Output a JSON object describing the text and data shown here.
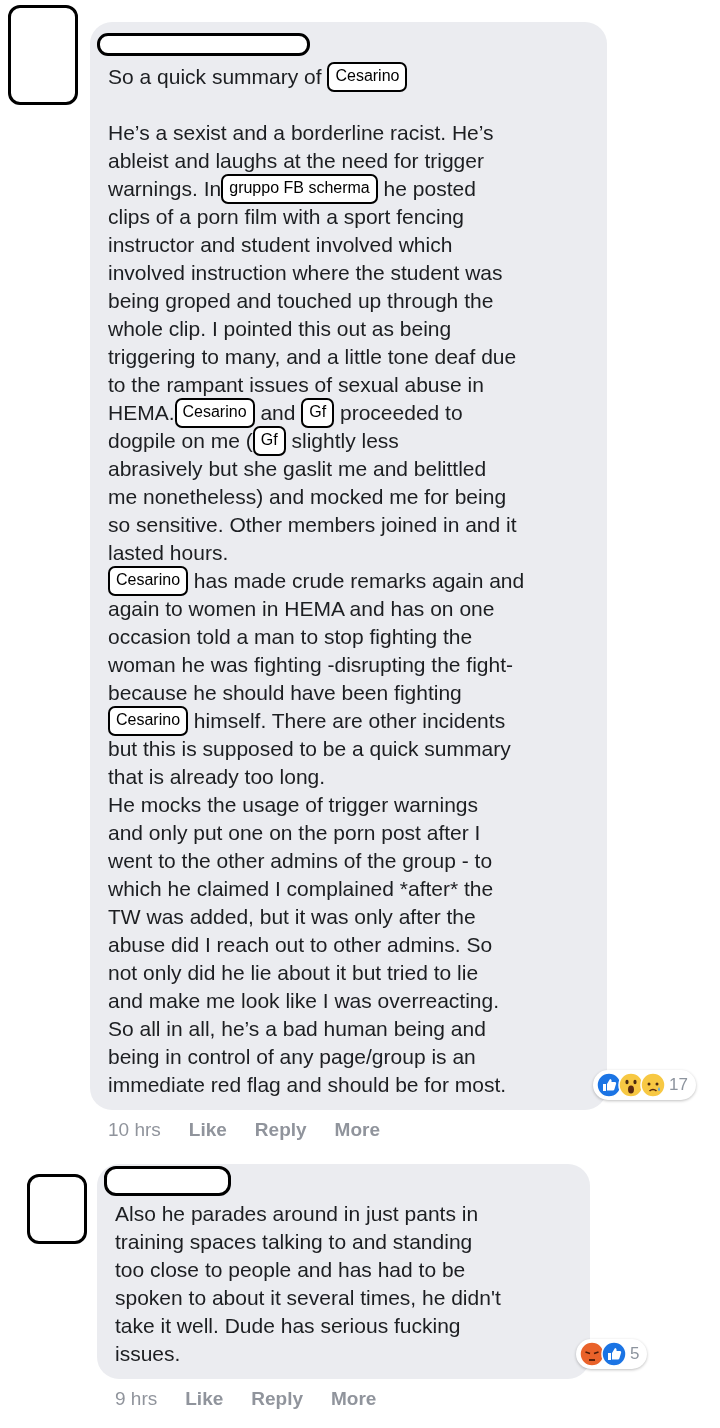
{
  "comments": [
    {
      "paragraphs": [
        [
          [
            {
              "kind": "text",
              "text": "So a quick summary of "
            },
            {
              "kind": "tag",
              "text": "Cesarino"
            }
          ]
        ],
        [
          [
            {
              "kind": "text",
              "text": "He’s a sexist and a borderline racist. He’s"
            }
          ],
          [
            {
              "kind": "text",
              "text": "ableist and laughs at the need for trigger"
            }
          ],
          [
            {
              "kind": "text",
              "text": "warnings. In"
            },
            {
              "kind": "tag",
              "text": "gruppo FB scherma"
            },
            {
              "kind": "text",
              "text": " he posted"
            }
          ],
          [
            {
              "kind": "text",
              "text": "clips of a porn film with a sport fencing"
            }
          ],
          [
            {
              "kind": "text",
              "text": "instructor and student involved which"
            }
          ],
          [
            {
              "kind": "text",
              "text": "involved instruction where the student was"
            }
          ],
          [
            {
              "kind": "text",
              "text": "being groped and touched up through the"
            }
          ],
          [
            {
              "kind": "text",
              "text": "whole clip. I pointed this out as being"
            }
          ],
          [
            {
              "kind": "text",
              "text": "triggering to many, and a little tone deaf due"
            }
          ],
          [
            {
              "kind": "text",
              "text": "to the rampant issues of sexual abuse in"
            }
          ],
          [
            {
              "kind": "text",
              "text": "HEMA."
            },
            {
              "kind": "tag",
              "text": "Cesarino"
            },
            {
              "kind": "text",
              "text": " and "
            },
            {
              "kind": "tag",
              "text": "Gf"
            },
            {
              "kind": "text",
              "text": " proceeded to"
            }
          ],
          [
            {
              "kind": "text",
              "text": "dogpile on me ("
            },
            {
              "kind": "tag",
              "text": "Gf"
            },
            {
              "kind": "text",
              "text": " slightly less"
            }
          ],
          [
            {
              "kind": "text",
              "text": "abrasively but she gaslit me and belittled"
            }
          ],
          [
            {
              "kind": "text",
              "text": "me nonetheless) and mocked me for being"
            }
          ],
          [
            {
              "kind": "text",
              "text": "so sensitive. Other members joined in and it"
            }
          ],
          [
            {
              "kind": "text",
              "text": "lasted hours."
            }
          ],
          [
            {
              "kind": "tag",
              "text": "Cesarino"
            },
            {
              "kind": "text",
              "text": " has made crude remarks again and"
            }
          ],
          [
            {
              "kind": "text",
              "text": "again to women in HEMA and has on one"
            }
          ],
          [
            {
              "kind": "text",
              "text": "occasion told a man to stop fighting the"
            }
          ],
          [
            {
              "kind": "text",
              "text": "woman he was fighting -disrupting the fight-"
            }
          ],
          [
            {
              "kind": "text",
              "text": "because he should have been fighting"
            }
          ],
          [
            {
              "kind": "tag",
              "text": "Cesarino"
            },
            {
              "kind": "text",
              "text": " himself. There are other incidents"
            }
          ],
          [
            {
              "kind": "text",
              "text": "but this is supposed to be a quick summary"
            }
          ],
          [
            {
              "kind": "text",
              "text": "that is already too long."
            }
          ],
          [
            {
              "kind": "text",
              "text": "He mocks the usage of trigger warnings"
            }
          ],
          [
            {
              "kind": "text",
              "text": "and only put one on the porn post after I"
            }
          ],
          [
            {
              "kind": "text",
              "text": "went to the other admins of the group - to"
            }
          ],
          [
            {
              "kind": "text",
              "text": "which he claimed I complained *after* the"
            }
          ],
          [
            {
              "kind": "text",
              "text": "TW was added, but it was only after the"
            }
          ],
          [
            {
              "kind": "text",
              "text": "abuse did I reach out to other admins. So"
            }
          ],
          [
            {
              "kind": "text",
              "text": "not only did he lie about it but tried to lie"
            }
          ],
          [
            {
              "kind": "text",
              "text": "and make me look like I was overreacting."
            }
          ],
          [
            {
              "kind": "text",
              "text": "So all in all, he’s a bad human being and"
            }
          ],
          [
            {
              "kind": "text",
              "text": "being in control of any page/group is an"
            }
          ],
          [
            {
              "kind": "text",
              "text": "immediate red flag and should be for most."
            }
          ]
        ]
      ],
      "reactions": [
        {
          "kind": "like"
        },
        {
          "kind": "wow"
        },
        {
          "kind": "sad"
        }
      ],
      "reaction_count": "17",
      "time": "10 hrs",
      "actions": [
        "Like",
        "Reply",
        "More"
      ]
    },
    {
      "paragraphs": [
        [
          [
            {
              "kind": "text",
              "text": "Also he parades around in just pants in"
            }
          ],
          [
            {
              "kind": "text",
              "text": "training spaces talking to and standing"
            }
          ],
          [
            {
              "kind": "text",
              "text": "too close to people and has had to be"
            }
          ],
          [
            {
              "kind": "text",
              "text": "spoken to about it several times, he didn't"
            }
          ],
          [
            {
              "kind": "text",
              "text": "take it well. Dude has serious fucking"
            }
          ],
          [
            {
              "kind": "text",
              "text": "issues."
            }
          ]
        ]
      ],
      "reactions": [
        {
          "kind": "angry"
        },
        {
          "kind": "like"
        }
      ],
      "reaction_count": "5",
      "time": "9 hrs",
      "actions": [
        "Like",
        "Reply",
        "More"
      ]
    }
  ]
}
